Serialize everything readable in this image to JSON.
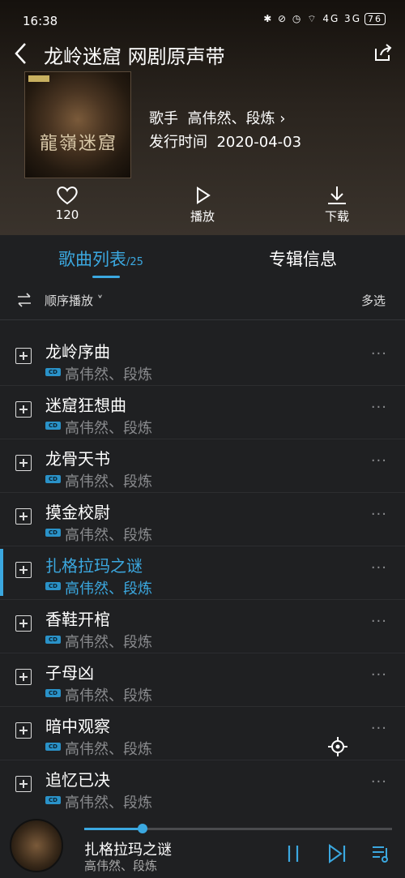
{
  "status": {
    "time": "16:38",
    "battery": "76",
    "signal": "4G 3G"
  },
  "header": {
    "title": "龙岭迷窟 网剧原声带"
  },
  "album": {
    "cover_text": "龍嶺迷窟",
    "artist_label": "歌手",
    "artist": "高伟然、段炼",
    "release_label": "发行时间",
    "release_date": "2020-04-03"
  },
  "actions": {
    "like_count": "120",
    "play_label": "播放",
    "download_label": "下载"
  },
  "tabs": {
    "songs_label": "歌曲列表",
    "songs_count": "/25",
    "info_label": "专辑信息"
  },
  "toolbar": {
    "order_label": "顺序播放 ˅",
    "multi_label": "多选"
  },
  "colors": {
    "accent": "#3ba8e0",
    "background": "#1f2022"
  },
  "songs": [
    {
      "title": "龙岭序曲",
      "artist": "高伟然、段炼",
      "active": false
    },
    {
      "title": "迷窟狂想曲",
      "artist": "高伟然、段炼",
      "active": false
    },
    {
      "title": "龙骨天书",
      "artist": "高伟然、段炼",
      "active": false
    },
    {
      "title": "摸金校尉",
      "artist": "高伟然、段炼",
      "active": false
    },
    {
      "title": "扎格拉玛之谜",
      "artist": "高伟然、段炼",
      "active": true
    },
    {
      "title": "香鞋开棺",
      "artist": "高伟然、段炼",
      "active": false
    },
    {
      "title": "子母凶",
      "artist": "高伟然、段炼",
      "active": false
    },
    {
      "title": "暗中观察",
      "artist": "高伟然、段炼",
      "active": false
    },
    {
      "title": "追忆已决",
      "artist": "高伟然、段炼",
      "active": false
    }
  ],
  "player": {
    "title": "扎格拉玛之谜",
    "artist": "高伟然、段炼",
    "progress": 0.19
  }
}
